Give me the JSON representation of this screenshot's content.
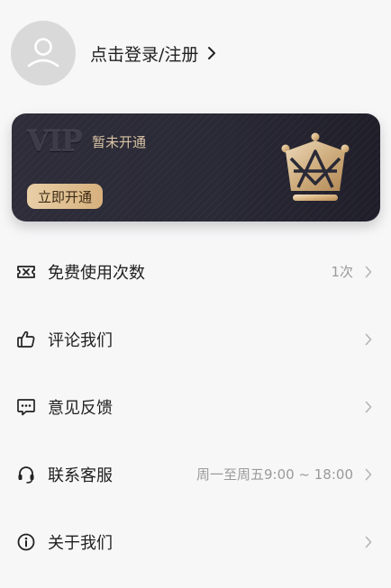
{
  "profile": {
    "login_label": "点击登录/注册",
    "avatar_icon": "user-avatar-icon",
    "arrow_icon": "chevron-right-icon"
  },
  "vip": {
    "logo_text": "VIP",
    "status": "暂未开通",
    "button_label": "立即开通",
    "badge_icon": "crown-icon",
    "colors": {
      "card_bg": "#2a2936",
      "gold": "#d6b07d",
      "gold_text": "#d8c3a3"
    }
  },
  "menu": [
    {
      "icon": "ticket-icon",
      "label": "免费使用次数",
      "value": "1次"
    },
    {
      "icon": "thumbs-up-icon",
      "label": "评论我们",
      "value": ""
    },
    {
      "icon": "chat-bubble-icon",
      "label": "意见反馈",
      "value": ""
    },
    {
      "icon": "headset-icon",
      "label": "联系客服",
      "value": "周一至周五9:00 ~ 18:00"
    },
    {
      "icon": "info-icon",
      "label": "关于我们",
      "value": ""
    }
  ]
}
